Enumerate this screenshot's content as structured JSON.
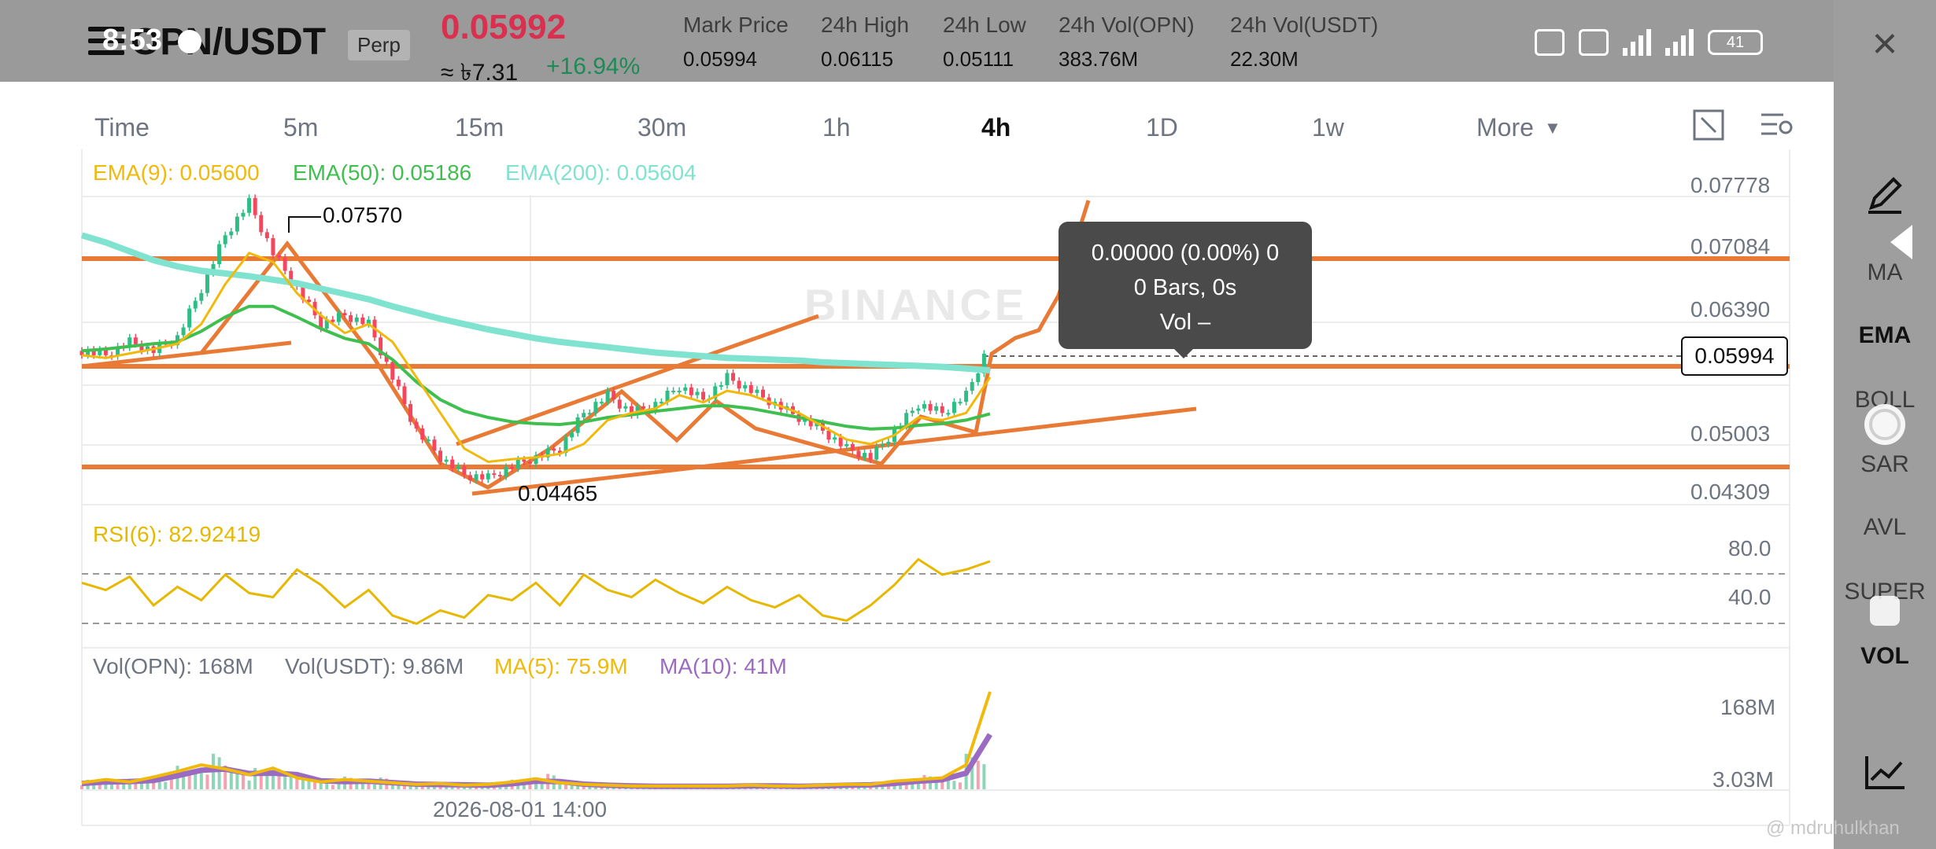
{
  "status": {
    "time": "8:53",
    "battery": "41"
  },
  "header": {
    "symbol": "OPN/USDT",
    "contract": "Perp",
    "last_price": "0.05992",
    "local_price": "≈ ৳7.31",
    "change_pct": "+16.94%",
    "stats": [
      {
        "label": "Mark Price",
        "value": "0.05994"
      },
      {
        "label": "24h High",
        "value": "0.06115"
      },
      {
        "label": "24h Low",
        "value": "0.05111"
      },
      {
        "label": "24h Vol(OPN)",
        "value": "383.76M"
      },
      {
        "label": "24h Vol(USDT)",
        "value": "22.30M"
      }
    ]
  },
  "timeframes": [
    {
      "label": "Time",
      "active": false
    },
    {
      "label": "5m",
      "active": false
    },
    {
      "label": "15m",
      "active": false
    },
    {
      "label": "30m",
      "active": false
    },
    {
      "label": "1h",
      "active": false
    },
    {
      "label": "4h",
      "active": true
    },
    {
      "label": "1D",
      "active": false
    },
    {
      "label": "1w",
      "active": false
    },
    {
      "label": "More",
      "active": false
    }
  ],
  "indicators": {
    "ema9": {
      "label": "EMA(9): 0.05600",
      "color": "#f0b90b"
    },
    "ema50": {
      "label": "EMA(50): 0.05186",
      "color": "#3fbf4f"
    },
    "ema200": {
      "label": "EMA(200): 0.05604",
      "color": "#7fe3cf"
    },
    "rsi": {
      "label": "RSI(6): 82.92419",
      "color": "#e6b800"
    },
    "vol_opn": {
      "label": "Vol(OPN): 168M",
      "color": "#6e7580"
    },
    "vol_usdt": {
      "label": "Vol(USDT): 9.86M",
      "color": "#6e7580"
    },
    "vol_ma5": {
      "label": "MA(5): 75.9M",
      "color": "#f0b90b"
    },
    "vol_ma10": {
      "label": "MA(10): 41M",
      "color": "#9b6bc1"
    }
  },
  "price_axis": [
    "0.07778",
    "0.07084",
    "0.06390",
    "0.05003",
    "0.04309"
  ],
  "rsi_axis": [
    "80.0",
    "40.0"
  ],
  "vol_axis": [
    "168M",
    "3.03M"
  ],
  "current_price_tag": "0.05994",
  "annotations": {
    "high": "0.07570",
    "low": "0.04465"
  },
  "tooltip": {
    "line1": "0.00000 (0.00%) 0",
    "line2": "0 Bars, 0s",
    "line3": "Vol –"
  },
  "date_label": "2026-08-01 14:00",
  "watermark": "BINANCE",
  "side_panel": {
    "items": [
      {
        "label": "MA",
        "active": false
      },
      {
        "label": "EMA",
        "active": true
      },
      {
        "label": "BOLL",
        "active": false
      },
      {
        "label": "SAR",
        "active": false
      },
      {
        "label": "AVL",
        "active": false
      },
      {
        "label": "SUPER",
        "active": false
      },
      {
        "label": "VOL",
        "active": true
      }
    ]
  },
  "credit": "@ mdruhulkhan",
  "chart_data": {
    "type": "candlestick",
    "interval": "4h",
    "price_range": [
      0.04309,
      0.07778
    ],
    "ema9_path": [
      0.0585,
      0.0582,
      0.0587,
      0.0592,
      0.0598,
      0.062,
      0.0665,
      0.07,
      0.069,
      0.0655,
      0.063,
      0.061,
      0.062,
      0.06,
      0.056,
      0.052,
      0.048,
      0.0465,
      0.0468,
      0.047,
      0.0474,
      0.0485,
      0.0512,
      0.052,
      0.0525,
      0.054,
      0.0532,
      0.0545,
      0.054,
      0.053,
      0.052,
      0.0505,
      0.049,
      0.0485,
      0.0495,
      0.0515,
      0.0512,
      0.052,
      0.056
    ],
    "ema50_path": [
      0.059,
      0.0592,
      0.0595,
      0.0598,
      0.06,
      0.0612,
      0.0628,
      0.064,
      0.064,
      0.0628,
      0.0615,
      0.0604,
      0.0598,
      0.058,
      0.0555,
      0.0535,
      0.0522,
      0.0515,
      0.051,
      0.0508,
      0.0507,
      0.051,
      0.0515,
      0.0518,
      0.0522,
      0.0525,
      0.0528,
      0.0528,
      0.0525,
      0.052,
      0.0515,
      0.051,
      0.0505,
      0.0502,
      0.0503,
      0.0506,
      0.0508,
      0.0512,
      0.0519
    ],
    "ema200_path": [
      0.072,
      0.0712,
      0.0702,
      0.0692,
      0.0685,
      0.068,
      0.0677,
      0.0674,
      0.067,
      0.0666,
      0.066,
      0.0654,
      0.0648,
      0.064,
      0.0633,
      0.0626,
      0.062,
      0.0614,
      0.0609,
      0.0604,
      0.06,
      0.0597,
      0.0594,
      0.0591,
      0.0588,
      0.0586,
      0.0584,
      0.0582,
      0.0581,
      0.058,
      0.0579,
      0.0577,
      0.0576,
      0.0575,
      0.0574,
      0.0573,
      0.0572,
      0.057,
      0.0568
    ],
    "close_path": [
      0.059,
      0.0585,
      0.06,
      0.059,
      0.0605,
      0.066,
      0.072,
      0.0757,
      0.07,
      0.066,
      0.062,
      0.063,
      0.062,
      0.056,
      0.05,
      0.047,
      0.045,
      0.0447,
      0.046,
      0.047,
      0.048,
      0.052,
      0.054,
      0.052,
      0.053,
      0.055,
      0.0535,
      0.056,
      0.0545,
      0.053,
      0.0515,
      0.05,
      0.048,
      0.047,
      0.05,
      0.053,
      0.052,
      0.054,
      0.0599
    ],
    "rsi_path": [
      62,
      55,
      68,
      40,
      58,
      45,
      70,
      52,
      48,
      75,
      60,
      38,
      55,
      30,
      22,
      35,
      28,
      50,
      45,
      62,
      40,
      70,
      55,
      48,
      65,
      52,
      42,
      58,
      45,
      38,
      50,
      30,
      25,
      40,
      60,
      85,
      70,
      75,
      83
    ],
    "volume_ma5_path": [
      0.8,
      1.2,
      0.9,
      1.5,
      2.2,
      3.0,
      2.5,
      1.8,
      2.6,
      1.4,
      0.9,
      1.2,
      1.0,
      0.8,
      0.6,
      0.7,
      0.5,
      0.6,
      0.9,
      1.3,
      0.8,
      0.6,
      0.5,
      0.4,
      0.4,
      0.4,
      0.4,
      0.4,
      0.5,
      0.4,
      0.4,
      0.5,
      0.6,
      0.6,
      1.0,
      1.2,
      1.4,
      3.0,
      12.0
    ]
  }
}
